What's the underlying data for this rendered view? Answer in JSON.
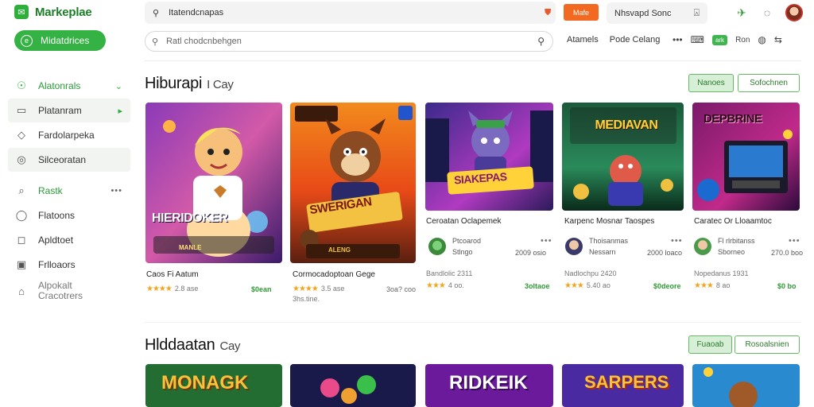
{
  "app": {
    "name": "Markeplae"
  },
  "sidebar": {
    "new_button": "Midatdrices",
    "items": [
      {
        "label": "Alatonrals",
        "icon": "check-circle-icon",
        "trail": "chevron-down"
      },
      {
        "label": "Platanram",
        "icon": "chat-bubble-icon",
        "trail": "arrow-right"
      },
      {
        "label": "Fardolarpeka",
        "icon": "tag-icon"
      },
      {
        "label": "Silceoratan",
        "icon": "target-icon"
      },
      {
        "label": "Rastk",
        "icon": "pin-icon",
        "trail": "dots"
      },
      {
        "label": "Flatoons",
        "icon": "circle-icon"
      },
      {
        "label": "Apldtoet",
        "icon": "bag-icon"
      },
      {
        "label": "Frlloaors",
        "icon": "box-icon"
      },
      {
        "label": "Alpokalt\nCracotrers",
        "icon": "home-icon"
      }
    ]
  },
  "topbar": {
    "search_placeholder": "Itatendcnapas",
    "orange_button": "Mafe",
    "search2_placeholder": "Nhsvapd Sonc"
  },
  "row2": {
    "search_placeholder": "Ratl chodcnbehgen",
    "links": [
      "Atamels",
      "Pode Celang"
    ],
    "badge": "ark",
    "badge_label": "Ron"
  },
  "section1": {
    "title": "Hiburapi",
    "subtitle": "I Cay",
    "btn_fill": "Nanoes",
    "btn_outline": "Sofochnen"
  },
  "section2": {
    "title": "Hlddaatan",
    "subtitle": "Cay",
    "btn_fill": "Fuaoab",
    "btn_outline": "Rosoalsnien"
  },
  "cards": [
    {
      "title": "Caos Fi Aatum",
      "rating": "2.8 ase",
      "price": "$0ean",
      "art_text": "HIERIDOKER",
      "badge": "MANLE"
    },
    {
      "title": "Cormocadoptoan Gege",
      "rating": "3.5 ase",
      "sub": "3hs.tine.",
      "price": "3oa? coo",
      "art_text": "SWERIGAN",
      "badge": "ALENG"
    },
    {
      "title": "Ceroatan Oclapemek",
      "dev1": "Ptcoarod",
      "dev2": "Stlngo",
      "date": "2009 osio",
      "meta": "Bandlolic 2311",
      "rating": "4 oo.",
      "price": "3oltaoe",
      "art_text": "SIAKEPAS"
    },
    {
      "title": "Karpenc Mosnar Taospes",
      "dev1": "Thoisanmas",
      "dev2": "Nessarn",
      "date": "2000 loaco",
      "meta": "Nadlochpu 2420",
      "rating": "5.40 ao",
      "price": "$0deore",
      "art_text": "MEDIAVAN"
    },
    {
      "title": "Caratec Or Lloaamtoc",
      "dev1": "Fl rlrbitanss",
      "dev2": "Sborneo",
      "date": "270.0 boo",
      "meta": "Nopedanus 1931",
      "rating": "8 ao",
      "price": "$0 bo",
      "art_text": "DEPBRINE"
    }
  ],
  "cards2": [
    {
      "art_text": "MONAGK"
    },
    {
      "art_text": ""
    },
    {
      "art_text": "RIDKEIK"
    },
    {
      "art_text": "SARPERS"
    },
    {
      "art_text": ""
    }
  ],
  "colors": {
    "accent": "#35b244",
    "orange": "#f26a21",
    "star": "#f4a51c"
  }
}
